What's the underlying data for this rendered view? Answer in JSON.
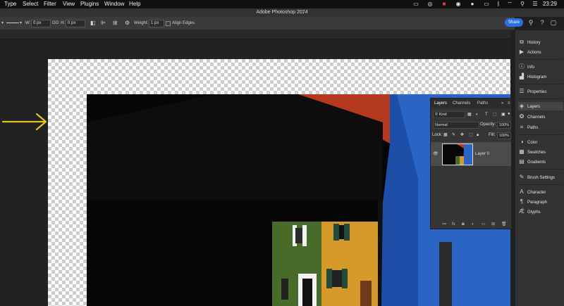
{
  "menubar": {
    "items": [
      "Type",
      "Select",
      "Filter",
      "View",
      "Plugins",
      "Window",
      "Help"
    ],
    "time": "23:29"
  },
  "window": {
    "title": "Adobe Photoshop 2024"
  },
  "options_bar": {
    "w_label": "W:",
    "w_value": "0 px",
    "go_label": "GO",
    "h_label": "H:",
    "h_value": "0 px",
    "weight_label": "Weight:",
    "weight_value": "1 px",
    "align_edges_label": "Align Edges",
    "share_label": "Share"
  },
  "dock": {
    "items": [
      {
        "label": "History",
        "icon": "history-icon"
      },
      {
        "label": "Actions",
        "icon": "play-icon"
      },
      {
        "label": "Info",
        "icon": "info-icon"
      },
      {
        "label": "Histogram",
        "icon": "histogram-icon"
      },
      {
        "label": "Properties",
        "icon": "properties-icon"
      },
      {
        "label": "Layers",
        "icon": "layers-icon"
      },
      {
        "label": "Channels",
        "icon": "channels-icon"
      },
      {
        "label": "Paths",
        "icon": "paths-icon"
      },
      {
        "label": "Color",
        "icon": "color-icon"
      },
      {
        "label": "Swatches",
        "icon": "swatches-icon"
      },
      {
        "label": "Gradients",
        "icon": "gradients-icon"
      },
      {
        "label": "Brush Settings",
        "icon": "brush-icon"
      },
      {
        "label": "Character",
        "icon": "character-icon"
      },
      {
        "label": "Paragraph",
        "icon": "paragraph-icon"
      },
      {
        "label": "Glyphs",
        "icon": "glyphs-icon"
      }
    ]
  },
  "layers_panel": {
    "tabs": [
      "Layers",
      "Channels",
      "Paths"
    ],
    "filter_label": "Kind",
    "blend_mode": "Normal",
    "opacity_label": "Opacity:",
    "opacity_value": "100%",
    "lock_label": "Lock:",
    "fill_label": "Fill:",
    "fill_value": "100%",
    "layer_name": "Layer 0"
  },
  "colors": {
    "accent": "#2e6fe0",
    "annotation_arrow": "#e3c02a"
  }
}
